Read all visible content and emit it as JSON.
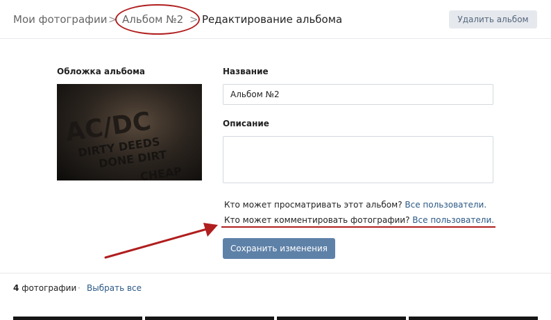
{
  "breadcrumb": {
    "my_photos": "Мои фотографии",
    "album": "Альбом №2",
    "current": "Редактирование альбома",
    "separator": ">"
  },
  "header": {
    "delete_album": "Удалить альбом"
  },
  "cover": {
    "label": "Обложка альбома",
    "image_text": [
      "AC/DC",
      "DIRTY DEEDS",
      "DONE DIRT",
      "CHEAP"
    ]
  },
  "form": {
    "name_label": "Название",
    "name_value": "Альбом №2",
    "description_label": "Описание",
    "description_value": ""
  },
  "privacy": {
    "view_question": "Кто может просматривать этот альбом?",
    "view_value": "Все пользователи.",
    "comment_question": "Кто может комментировать фотографии?",
    "comment_value": "Все пользователи."
  },
  "save_button": "Сохранить изменения",
  "footer": {
    "count_number": "4",
    "count_label": "фотографии",
    "separator": "·",
    "select_all": "Выбрать все"
  },
  "colors": {
    "annotation": "#b01e1e",
    "link": "#2a5885",
    "primary_button": "#5e81a8"
  }
}
